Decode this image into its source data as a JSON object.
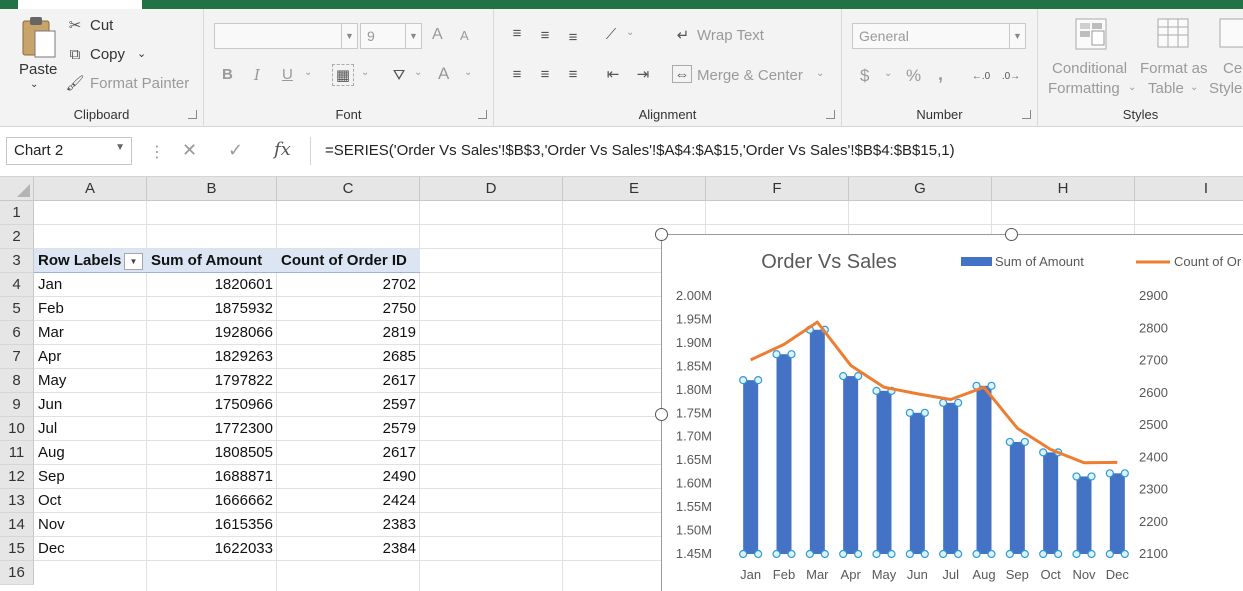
{
  "ribbon": {
    "clipboard": {
      "paste": "Paste",
      "cut": "Cut",
      "copy": "Copy",
      "format_painter": "Format Painter",
      "label": "Clipboard"
    },
    "font": {
      "font_size": "9",
      "increase": "A",
      "decrease": "A",
      "bold": "B",
      "italic": "I",
      "underline": "U",
      "font_color": "A",
      "label": "Font"
    },
    "alignment": {
      "wrap_text": "Wrap Text",
      "merge_center": "Merge & Center",
      "label": "Alignment"
    },
    "number": {
      "format": "General",
      "currency": "$",
      "percent": "%",
      "comma": ",",
      "label": "Number"
    },
    "styles": {
      "conditional_line1": "Conditional",
      "conditional_line2": "Formatting",
      "format_table_line1": "Format as",
      "format_table_line2": "Table",
      "cell_line1": "Cel",
      "cell_line2": "Style",
      "label": "Styles"
    }
  },
  "formula_bar": {
    "name_box": "Chart 2",
    "fx": "fx",
    "formula": "=SERIES('Order Vs Sales'!$B$3,'Order Vs Sales'!$A$4:$A$15,'Order Vs Sales'!$B$4:$B$15,1)"
  },
  "grid": {
    "columns": [
      "A",
      "B",
      "C",
      "D",
      "E",
      "F",
      "G",
      "H",
      "I"
    ],
    "rows": [
      "1",
      "2",
      "3",
      "4",
      "5",
      "6",
      "7",
      "8",
      "9",
      "10",
      "11",
      "12",
      "13",
      "14",
      "15",
      "16"
    ]
  },
  "pivot": {
    "headers": [
      "Row Labels",
      "Sum of Amount",
      "Count of Order ID"
    ],
    "rows": [
      {
        "label": "Jan",
        "amount": "1820601",
        "count": "2702"
      },
      {
        "label": "Feb",
        "amount": "1875932",
        "count": "2750"
      },
      {
        "label": "Mar",
        "amount": "1928066",
        "count": "2819"
      },
      {
        "label": "Apr",
        "amount": "1829263",
        "count": "2685"
      },
      {
        "label": "May",
        "amount": "1797822",
        "count": "2617"
      },
      {
        "label": "Jun",
        "amount": "1750966",
        "count": "2597"
      },
      {
        "label": "Jul",
        "amount": "1772300",
        "count": "2579"
      },
      {
        "label": "Aug",
        "amount": "1808505",
        "count": "2617"
      },
      {
        "label": "Sep",
        "amount": "1688871",
        "count": "2490"
      },
      {
        "label": "Oct",
        "amount": "1666662",
        "count": "2424"
      },
      {
        "label": "Nov",
        "amount": "1615356",
        "count": "2383"
      },
      {
        "label": "Dec",
        "amount": "1622033",
        "count": "2384"
      }
    ]
  },
  "chart_data": {
    "type": "bar",
    "title": "Order Vs Sales",
    "categories": [
      "Jan",
      "Feb",
      "Mar",
      "Apr",
      "May",
      "Jun",
      "Jul",
      "Aug",
      "Sep",
      "Oct",
      "Nov",
      "Dec"
    ],
    "series": [
      {
        "name": "Sum of Amount",
        "type": "bar",
        "axis": "left",
        "color": "#4472c4",
        "values": [
          1820601,
          1875932,
          1928066,
          1829263,
          1797822,
          1750966,
          1772300,
          1808505,
          1688871,
          1666662,
          1615356,
          1622033
        ]
      },
      {
        "name": "Count of Or",
        "type": "line",
        "axis": "right",
        "color": "#ed7d31",
        "values": [
          2702,
          2750,
          2819,
          2685,
          2617,
          2597,
          2579,
          2617,
          2490,
          2424,
          2383,
          2384
        ]
      }
    ],
    "y_left": {
      "min": 1450000,
      "max": 2000000,
      "ticks": [
        2000000,
        1950000,
        1900000,
        1850000,
        1800000,
        1750000,
        1700000,
        1650000,
        1600000,
        1550000,
        1500000,
        1450000
      ],
      "tick_labels": [
        "2.00M",
        "1.95M",
        "1.90M",
        "1.85M",
        "1.80M",
        "1.75M",
        "1.70M",
        "1.65M",
        "1.60M",
        "1.55M",
        "1.50M",
        "1.45M"
      ]
    },
    "y_right": {
      "min": 2100,
      "max": 2900,
      "ticks": [
        2900,
        2800,
        2700,
        2600,
        2500,
        2400,
        2300,
        2200,
        2100
      ],
      "tick_labels": [
        "2900",
        "2800",
        "2700",
        "2600",
        "2500",
        "2400",
        "2300",
        "2200",
        "2100"
      ]
    },
    "grid": false,
    "legend": "top"
  }
}
